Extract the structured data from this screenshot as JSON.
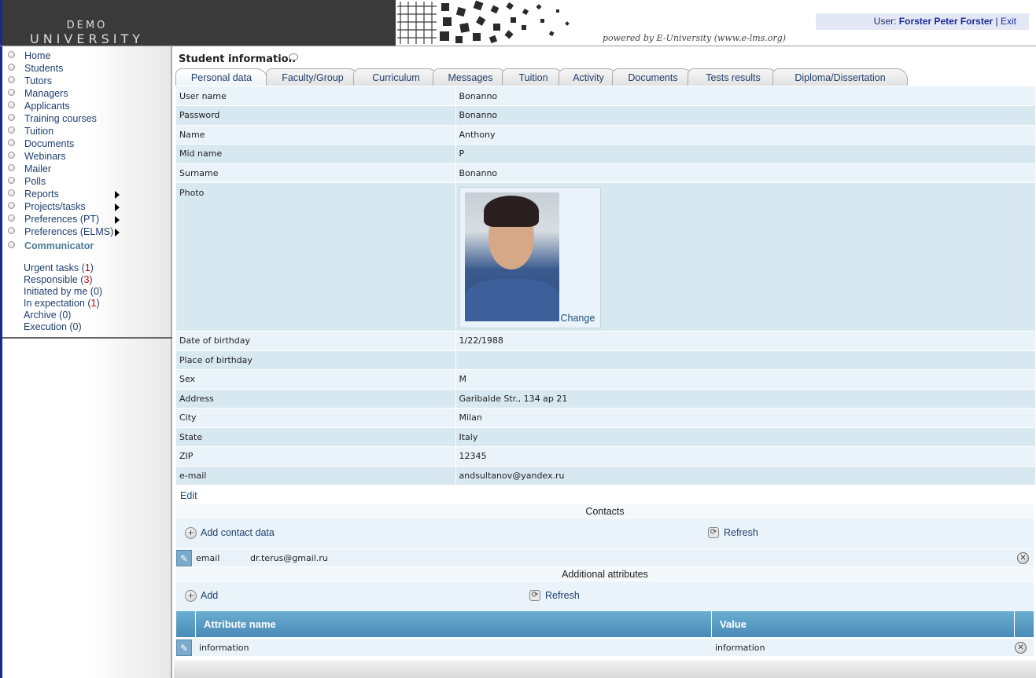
{
  "header": {
    "logo_top": "DEMO",
    "logo_bottom": "UNIVERSITY",
    "powered_by": "powered by E-University (www.e-lms.org)",
    "user_label": "User:",
    "user_name": "Forster Peter Forster",
    "separator": "|",
    "exit_label": "Exit"
  },
  "sidebar": {
    "menu": [
      {
        "label": "Home"
      },
      {
        "label": "Students"
      },
      {
        "label": "Tutors"
      },
      {
        "label": "Managers"
      },
      {
        "label": "Applicants"
      },
      {
        "label": "Training courses"
      },
      {
        "label": "Tuition"
      },
      {
        "label": "Documents"
      },
      {
        "label": "Webinars"
      },
      {
        "label": "Mailer"
      },
      {
        "label": "Polls"
      },
      {
        "label": "Reports",
        "submenu": true
      },
      {
        "label": "Projects/tasks",
        "submenu": true
      },
      {
        "label": "Preferences (PT)",
        "submenu": true
      },
      {
        "label": "Preferences (ELMS)",
        "submenu": true
      },
      {
        "label": "Communicator"
      }
    ],
    "tasks": [
      {
        "label": "Urgent tasks",
        "count": "1",
        "highlight": true
      },
      {
        "label": "Responsible",
        "count": "3",
        "highlight": true
      },
      {
        "label": "Initiated by me",
        "count": "0",
        "highlight": false
      },
      {
        "label": "In expectation",
        "count": "1",
        "highlight": true
      },
      {
        "label": "Archive",
        "count": "0",
        "highlight": false
      },
      {
        "label": "Execution",
        "count": "0",
        "highlight": false
      }
    ]
  },
  "main": {
    "title": "Student information",
    "tabs": [
      {
        "label": "Personal data",
        "active": true
      },
      {
        "label": "Faculty/Group"
      },
      {
        "label": "Curriculum"
      },
      {
        "label": "Messages"
      },
      {
        "label": "Tuition"
      },
      {
        "label": "Activity"
      },
      {
        "label": "Documents"
      },
      {
        "label": "Tests results"
      },
      {
        "label": "Diploma/Dissertation"
      }
    ],
    "fields": [
      {
        "label": "User name",
        "value": "Bonanno"
      },
      {
        "label": "Password",
        "value": "Bonanno"
      },
      {
        "label": "Name",
        "value": "Anthony"
      },
      {
        "label": "Mid name",
        "value": "P"
      },
      {
        "label": "Surname",
        "value": "Bonanno"
      },
      {
        "label": "Photo",
        "value": ""
      },
      {
        "label": "Date of birthday",
        "value": "1/22/1988"
      },
      {
        "label": "Place of birthday",
        "value": ""
      },
      {
        "label": "Sex",
        "value": "M"
      },
      {
        "label": "Address",
        "value": "Garibalde Str., 134 ap 21"
      },
      {
        "label": "City",
        "value": "Milan"
      },
      {
        "label": "State",
        "value": "Italy"
      },
      {
        "label": "ZIP",
        "value": "12345"
      },
      {
        "label": "e-mail",
        "value": "andsultanov@yandex.ru"
      }
    ],
    "photo_change_label": "Change",
    "edit_label": "Edit",
    "contacts": {
      "title": "Contacts",
      "add_label": "Add contact data",
      "refresh_label": "Refresh",
      "rows": [
        {
          "type": "email",
          "value": "dr.terus@gmail.ru"
        }
      ]
    },
    "attributes": {
      "title": "Additional attributes",
      "add_label": "Add",
      "refresh_label": "Refresh",
      "columns": [
        "Attribute name",
        "Value"
      ],
      "rows": [
        {
          "name": "information",
          "value": "information"
        }
      ]
    }
  },
  "icons": {
    "menu_bullet": "circle-bullet-icon",
    "submenu": "arrow-right-icon",
    "add": "plus-circle-icon",
    "refresh": "refresh-icon",
    "edit": "edit-pencil-icon",
    "delete": "delete-x-icon",
    "comment": "speech-bubble-icon"
  },
  "colors": {
    "link": "#1e3f6e",
    "header_dark": "#3a3a3a",
    "row_light": "#eaf3f9",
    "row_dark": "#d8e8f0",
    "table_header": "#5a9ac4",
    "count_highlight": "#cc0000"
  }
}
